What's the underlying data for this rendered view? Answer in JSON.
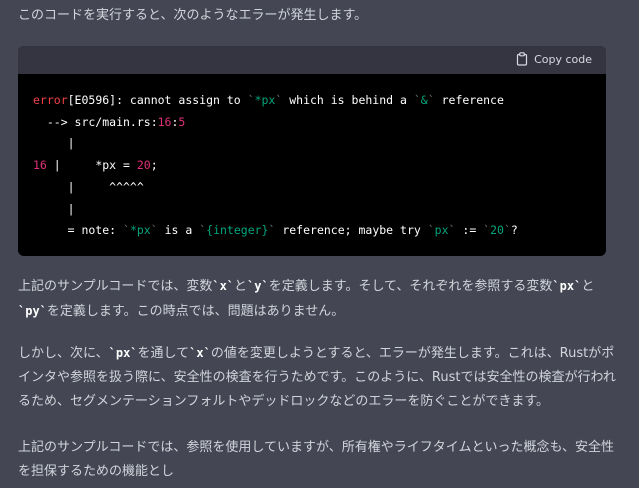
{
  "intro": "このコードを実行すると、次のようなエラーが発生します。",
  "code_block": {
    "copy_label": "Copy code",
    "copy_icon": "clipboard-icon",
    "lines": {
      "l1": {
        "error_kw": "error",
        "rest_a": "[E0596]: cannot assign to ",
        "tick1": "`",
        "px": "*px",
        "tick2": "`",
        "rest_b": " which is behind a ",
        "tick3": "`",
        "amp": "&",
        "tick4": "`",
        "rest_c": " reference"
      },
      "l2": {
        "arrow": "  --> src/main.rs:",
        "line_no": "16",
        "colon": ":",
        "col_no": "5"
      },
      "l3": "     |",
      "l4": {
        "gutter": "16",
        "bar": " |     ",
        "code_a": "*px = ",
        "num": "20",
        "code_b": ";"
      },
      "l5": "     |     ^^^^^",
      "l6": "     |",
      "l7": {
        "prefix": "     = note: ",
        "t1": "`",
        "px": "*px",
        "t2": "`",
        "mid1": " is a ",
        "t3": "`",
        "int": "{integer}",
        "t4": "`",
        "mid2": " reference; maybe try ",
        "t5": "`",
        "px2": "px",
        "t6": "`",
        "mid3": " := ",
        "t7": "`",
        "twenty": "20",
        "t8": "`",
        "end": "?"
      }
    }
  },
  "paragraph1": {
    "a": "上記のサンプルコードでは、変数",
    "code_x": "`x`",
    "b": "と",
    "code_y": "`y`",
    "c": "を定義します。そして、それぞれを参照する変数",
    "code_px": "`px`",
    "d": "と",
    "code_py": "`py`",
    "e": "を定義します。この時点では、問題はありません。"
  },
  "paragraph2": {
    "a": "しかし、次に、",
    "code_px": "`px`",
    "b": "を通して",
    "code_x": "`x`",
    "c": "の値を変更しようとすると、エラーが発生します。これは、Rustがポインタや参照を扱う際に、安全性の検査を行うためです。このように、Rustでは安全性の検査が行われるため、セグメンテーションフォルトやデッドロックなどのエラーを防ぐことができます。"
  },
  "paragraph3": "上記のサンプルコードでは、参照を使用していますが、所有権やライフタイムといった概念も、安全性を担保するための機能とし"
}
